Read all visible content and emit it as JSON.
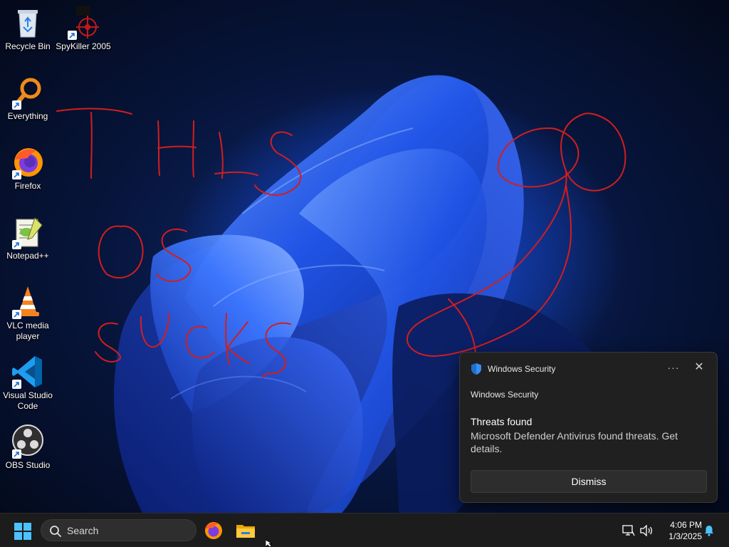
{
  "desktop_icons": [
    {
      "label": "Recycle Bin",
      "icon": "recycle-bin-icon"
    },
    {
      "label": "SpyKiller 2005",
      "icon": "crosshair-icon"
    },
    {
      "label": "Everything",
      "icon": "magnifier-icon"
    },
    {
      "label": "Firefox",
      "icon": "firefox-icon"
    },
    {
      "label": "Notepad++",
      "icon": "notepad-plus-plus-icon"
    },
    {
      "label": "VLC media player",
      "icon": "vlc-cone-icon"
    },
    {
      "label": "Visual Studio Code",
      "icon": "vscode-icon"
    },
    {
      "label": "OBS Studio",
      "icon": "obs-icon"
    }
  ],
  "scribble_text": [
    "THIS",
    "OS",
    "SUCKS"
  ],
  "notification": {
    "header": "Windows Security",
    "more_glyph": "···",
    "close_glyph": "✕",
    "app_name": "Windows Security",
    "title": "Threats found",
    "body": "Microsoft Defender Antivirus found threats. Get details.",
    "dismiss_label": "Dismiss"
  },
  "taskbar": {
    "search_placeholder": "Search",
    "pinned": [
      "firefox-icon",
      "file-explorer-icon"
    ],
    "time": "4:06 PM",
    "date": "1/3/2025"
  },
  "colors": {
    "scribble": "#d21e1e",
    "wallpaper_accent": "#1d4fe0",
    "taskbar": "#1c1c1c",
    "toast": "#202020"
  }
}
